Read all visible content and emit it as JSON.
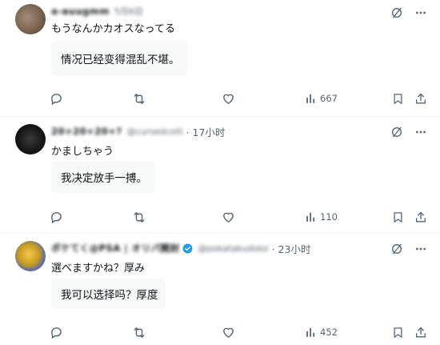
{
  "posts": [
    {
      "author_name": "a-auugmm",
      "author_handle": "5月6日",
      "timestamp": "",
      "text": "もうなんかカオスなってる",
      "translation": "情况已经变得混乱不堪。",
      "views": "667"
    },
    {
      "author_name": "20+20+20+?",
      "author_handle": "@cursedcolli",
      "timestamp": "· 17小时",
      "text": "かましちゃう",
      "translation": "我决定放手一搏。",
      "views": "110"
    },
    {
      "author_name": "ポケてく@PSA | オリパ開封",
      "author_handle": "@pokatakudoko",
      "timestamp": "· 23小时",
      "text": "選べますかね？厚み",
      "translation": "我可以选择吗？厚度",
      "views": "452"
    }
  ],
  "icons": {
    "grok": "grok-icon",
    "more": "more-icon",
    "reply": "reply-icon",
    "retweet": "retweet-icon",
    "like": "heart-icon",
    "views": "views-icon",
    "bookmark": "bookmark-icon",
    "share": "share-icon"
  },
  "colors": {
    "text": "#0f1419",
    "secondary": "#536471",
    "bubble": "#f7f9f9",
    "divider": "#eff3f4",
    "verified": "#1d9bf0"
  }
}
